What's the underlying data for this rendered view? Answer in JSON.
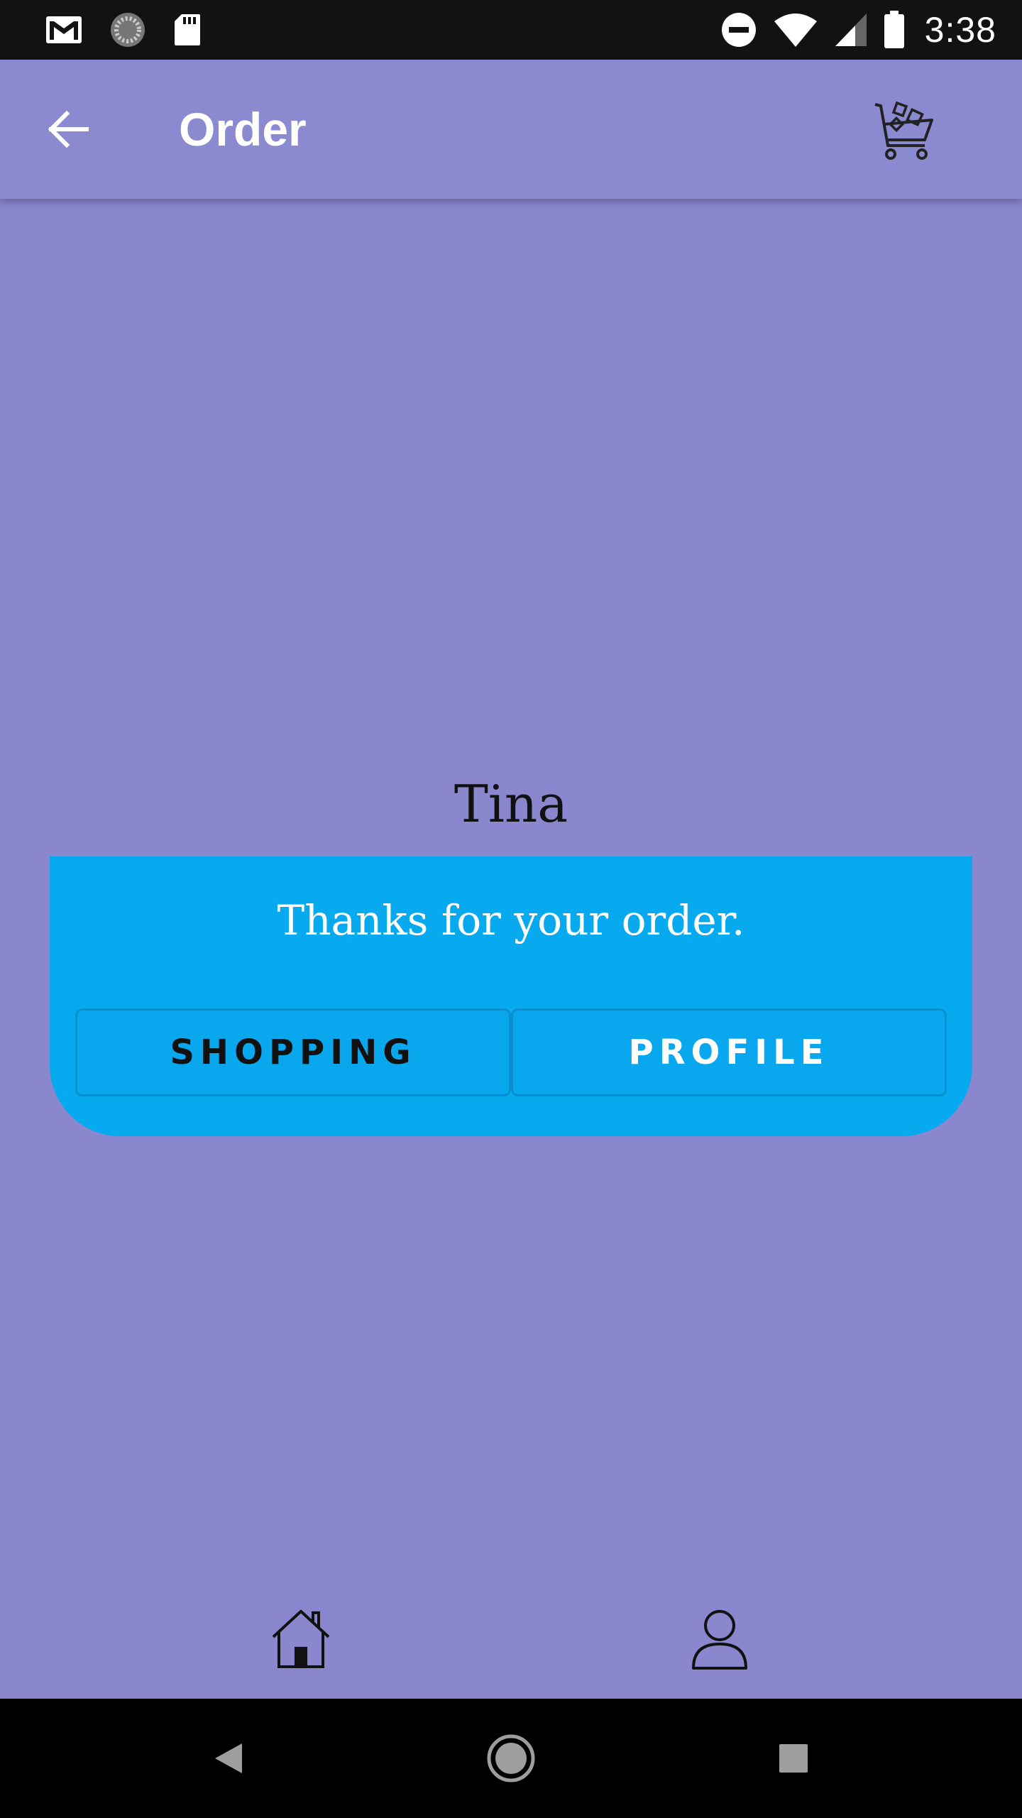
{
  "status_bar": {
    "time": "3:38",
    "left_icons": [
      "gmail-icon",
      "sync-icon",
      "sd-card-icon"
    ],
    "right_icons": [
      "do-not-disturb-icon",
      "wifi-icon",
      "signal-icon",
      "battery-icon"
    ]
  },
  "app_bar": {
    "title": "Order",
    "back_icon": "arrow-back-icon",
    "cart_icon": "shopping-cart-icon"
  },
  "content": {
    "customer_name": "Tina",
    "message": "Thanks for your order.",
    "buttons": {
      "shopping_label": "SHOPPING",
      "profile_label": "PROFILE"
    }
  },
  "bottom_nav": {
    "items": [
      {
        "icon": "home-icon"
      },
      {
        "icon": "person-icon"
      }
    ]
  },
  "colors": {
    "background": "#8a87cf",
    "card": "#07a9ef",
    "status_bar": "#121212",
    "system_nav": "#000000"
  }
}
